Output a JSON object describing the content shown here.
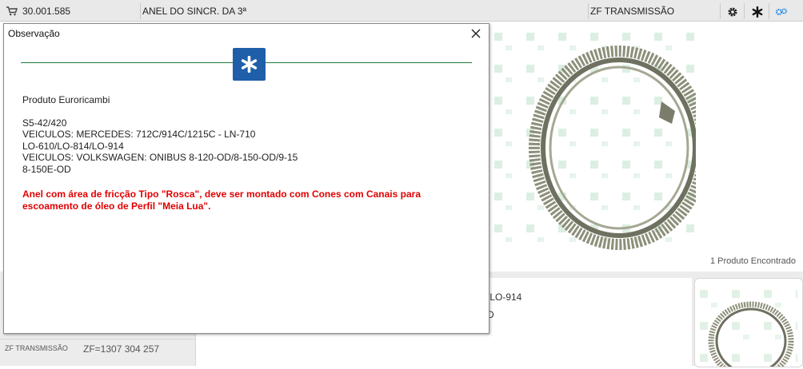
{
  "result": {
    "code": "30.001.585",
    "description": "ANEL DO SINCR. DA 3ª",
    "brand": "ZF TRANSMISSÃO",
    "colors": {
      "row_bg": "#e9e9e9",
      "accent": "#1e88e5"
    }
  },
  "results_count": "1 Produto Encontrado",
  "details": {
    "line1": "/LO-914",
    "line2": "D"
  },
  "references": [
    {
      "label": "ZF TRANSMISSÃO",
      "value": "ZF=1307 304 257"
    }
  ],
  "modal": {
    "title": "Observação",
    "header_icon": "asterisk-icon",
    "intro": "Produto Euroricambi",
    "lines": [
      "S5-42/420",
      "VEICULOS: MERCEDES: 712C/914C/1215C - LN-710",
      "LO-610/LO-814/LO-914",
      "VEICULOS: VOLKSWAGEN: ONIBUS 8-120-OD/8-150-OD/9-15",
      "8-150E-OD"
    ],
    "warning_lines": [
      "Anel com área de fricção Tipo \"Rosca\", deve ser montado com Cones com Canais para",
      "escoamento de óleo de Perfil \"Meia Lua\"."
    ],
    "colors": {
      "divider": "#1e7a3c",
      "badge": "#1f5ea8",
      "warning": "#e00000"
    }
  }
}
